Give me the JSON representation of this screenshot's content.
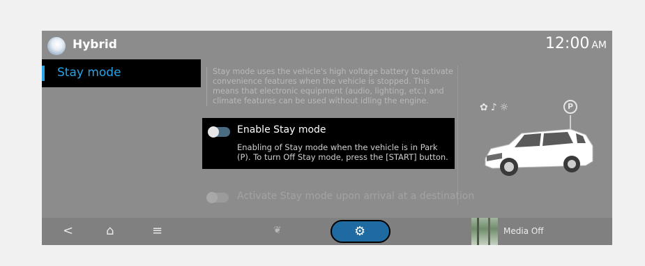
{
  "header": {
    "app_title": "Hybrid",
    "time": "12:00",
    "ampm": "AM",
    "app_icon": "app-bubble-icon"
  },
  "menu": {
    "active_item": "Stay mode"
  },
  "content": {
    "description": "Stay mode uses the vehicle's high voltage battery to activate convenience features when the vehicle is stopped. This means that electronic equipment (audio, lighting, etc.) and climate features can be used without idling the engine.",
    "enable_option": {
      "title": "Enable Stay mode",
      "description": "Enabling of Stay mode when the vehicle is in Park (P). To turn Off Stay mode, press the [START] button.",
      "state": "off"
    },
    "arrival_option": {
      "title": "Activate Stay mode upon arrival at a destination",
      "state": "disabled"
    },
    "illustration": {
      "feature_icons": [
        "fan-icon",
        "music-note-icon",
        "light-bulb-icon"
      ],
      "park_badge": "P"
    }
  },
  "bottom_bar": {
    "back": "<",
    "home": "⌂",
    "menu": "≡",
    "media_label": "Media Off"
  },
  "colors": {
    "accent": "#27a3e6",
    "settings_button": "#1f6aa0",
    "screen_bg": "#8c8c8c"
  }
}
